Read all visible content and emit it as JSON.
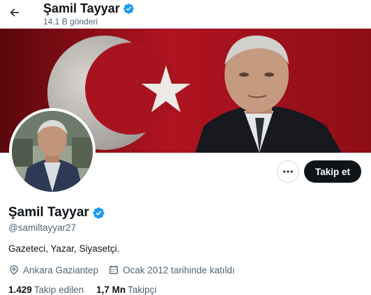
{
  "header": {
    "back_icon": "arrow-left-icon",
    "name": "Şamil Tayyar",
    "post_count": "14,1 B gönderi"
  },
  "profile": {
    "name": "Şamil Tayyar",
    "verified_icon": "verified-badge-icon",
    "handle": "@samiltayyar27",
    "bio": "Gazeteci, Yazar, Siyasetçi.",
    "location": "Ankara Gaziantep",
    "location_icon": "location-pin-icon",
    "joined": "Ocak 2012 tarihinde katıldı",
    "joined_icon": "calendar-icon",
    "following_count": "1.429",
    "following_label": "Takip edilen",
    "followers_count": "1,7 Mn",
    "followers_label": "Takipçi"
  },
  "actions": {
    "more_icon": "more-horizontal-icon",
    "follow_label": "Takip et"
  },
  "colors": {
    "verified": "#1d9bf0",
    "banner_red": "#7a0b12",
    "follow_bg": "#0f1419",
    "secondary_text": "#536471"
  }
}
